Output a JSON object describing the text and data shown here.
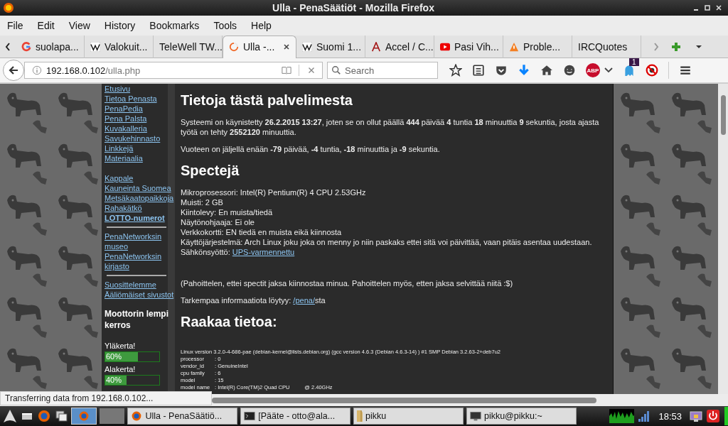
{
  "window": {
    "title": "Ulla - PenaSäätiöt - Mozilla Firefox"
  },
  "menu": [
    "File",
    "Edit",
    "View",
    "History",
    "Bookmarks",
    "Tools",
    "Help"
  ],
  "tabs": [
    {
      "label": "suolapa...",
      "selected": false,
      "kind": "google"
    },
    {
      "label": "Valokuit...",
      "selected": false,
      "kind": "wiki"
    },
    {
      "label": "TeleWell TW...",
      "selected": false,
      "kind": "plain"
    },
    {
      "label": "Ulla -...",
      "selected": true,
      "kind": "loading"
    },
    {
      "label": "Suomi 1...",
      "selected": false,
      "kind": "wiki"
    },
    {
      "label": "Accel / C...",
      "selected": false,
      "kind": "serif"
    },
    {
      "label": "Pasi Vih...",
      "selected": false,
      "kind": "video"
    },
    {
      "label": "Proble...",
      "selected": false,
      "kind": "warning"
    },
    {
      "label": "IRCQuotes",
      "selected": false,
      "kind": "plain"
    }
  ],
  "address": {
    "host": "192.168.0.102",
    "path": "/ulla.php"
  },
  "search": {
    "placeholder": "Search"
  },
  "toolbar": {
    "adblock_label": "ABP",
    "badge": "1"
  },
  "sidebar": {
    "items": [
      {
        "kind": "link",
        "text": "Etusivu",
        "bold": false
      },
      {
        "kind": "link",
        "text": "Tietoa Penasta",
        "bold": false
      },
      {
        "kind": "link",
        "text": "PenaPedia",
        "bold": false
      },
      {
        "kind": "link",
        "text": "Pena Palsta",
        "bold": false
      },
      {
        "kind": "link",
        "text": "Kuvakalleria",
        "bold": false
      },
      {
        "kind": "link",
        "text": "Savukehinnasto",
        "bold": false
      },
      {
        "kind": "link",
        "text": "Linkkejä",
        "bold": false
      },
      {
        "kind": "link",
        "text": "Materiaalia",
        "bold": false
      },
      {
        "kind": "gap"
      },
      {
        "kind": "link",
        "text": "Kappale",
        "bold": false
      },
      {
        "kind": "link",
        "text": "Kauneinta Suomea",
        "bold": false
      },
      {
        "kind": "link",
        "text": "Metsäkaatopaikkoja",
        "bold": false
      },
      {
        "kind": "link",
        "text": "Rahakätkö",
        "bold": false
      },
      {
        "kind": "link",
        "text": "LOTTO-numerot",
        "bold": true
      },
      {
        "kind": "rule"
      },
      {
        "kind": "link",
        "text": "PenaNetworksin museo",
        "bold": false
      },
      {
        "kind": "link",
        "text": "PenaNetworksin kirjasto",
        "bold": false
      },
      {
        "kind": "rule"
      },
      {
        "kind": "link",
        "text": "Suosittelemme",
        "bold": false
      },
      {
        "kind": "link",
        "text": "Ääliömäiset sivustot",
        "bold": false
      }
    ],
    "widget_title": "Moottorin lempi kerros",
    "meters": [
      {
        "label": "Yläkerta!",
        "level": 0.6,
        "reading": "60%"
      },
      {
        "label": "Alakerta!",
        "level": 0.4,
        "reading": "40%"
      }
    ]
  },
  "main": {
    "heading": "Tietoja tästä palvelimesta",
    "paragraphs": [
      "Systeemi on käynistetty **26.2.2015 13:27**, joten se on ollut päällä **444** päivää **4** tuntia **18** minuuttia **9** sekuntia, josta ajasta työtä on tehty **2552120** minuuttia.",
      "Vuoteen on jäljellä enään **-79** päivää, **-4** tuntia, **-18** minuuttia ja **-9** sekuntia."
    ],
    "specs_heading": "Spectejä",
    "specs": [
      {
        "text": "Mikroprosessori: Intel(R) Pentium(R) 4 CPU 2.53GHz"
      },
      {
        "text": "Muisti: 2 GB"
      },
      {
        "text": "Kiintolevy: En muista/tiedä"
      },
      {
        "text": "Näytönohjaaja: Ei ole"
      },
      {
        "text": "Verkkokortti: EN tiedä en muista eikä kiinnosta"
      },
      {
        "text": "Käyttöjärjestelmä: Arch Linux joku joka on menny jo niin paskaks ettei sitä voi päivittää, vaan pitäis asentaa uudestaan."
      },
      {
        "text": "Sähkönsyöttö:",
        "link": "UPS-varmennettu"
      }
    ],
    "apology": "(Pahoittelen, ettei spectit jaksa kiinnostaa minua. Pahoittelen myös, etten jaksa selvittää niitä :$)",
    "more_info": {
      "text": "Tarkempaa informaatiota löytyy:",
      "link": "/pena/",
      "suffix": "sta"
    },
    "raw_heading": "Raakaa tietoa:",
    "raw_first": "Linux version 3.2.0-4-686-pae (debian-kernel@lists.debian.org) (gcc version 4.6.3 (Debian 4.6.3-14) ) #1 SMP Debian 3.2.63-2+deb7u2",
    "raw_rows": [
      {
        "key": "processor",
        "value": ": 0"
      },
      {
        "key": "vendor_id",
        "value": ": GenuineIntel"
      },
      {
        "key": "cpu family",
        "value": ": 6"
      },
      {
        "key": "model",
        "value": ": 15"
      },
      {
        "key": "model name",
        "value": ": Intel(R) Core(TM)2 Quad CPU          @ 2.40GHz"
      }
    ]
  },
  "status_bar": "Transferring data from 192.168.0.102...",
  "taskbar": {
    "tasks": [
      {
        "label": "Ulla - PenaSäätiö...",
        "kind": "browser"
      },
      {
        "label": "[Pääte - otto@ala...",
        "kind": "terminal"
      },
      {
        "label": "pikku",
        "kind": "folder"
      },
      {
        "label": "pikku@pikku:~",
        "kind": "monitor"
      }
    ],
    "clock": "18:53"
  }
}
